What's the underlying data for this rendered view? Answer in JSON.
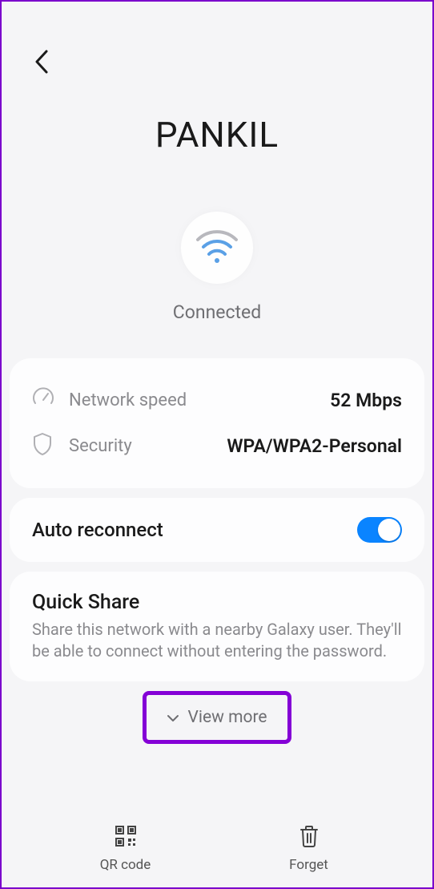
{
  "network": {
    "name": "PANKIL",
    "status": "Connected"
  },
  "info": {
    "speed_label": "Network speed",
    "speed_value": "52 Mbps",
    "security_label": "Security",
    "security_value": "WPA/WPA2-Personal"
  },
  "auto_reconnect": {
    "label": "Auto reconnect",
    "enabled": true
  },
  "quick_share": {
    "title": "Quick Share",
    "description": "Share this network with a nearby Galaxy user. They'll be able to connect without entering the password."
  },
  "view_more": {
    "label": "View more"
  },
  "bottom": {
    "qr_label": "QR code",
    "forget_label": "Forget"
  },
  "colors": {
    "accent": "#0a84ff",
    "highlight_border": "#8400d6"
  }
}
